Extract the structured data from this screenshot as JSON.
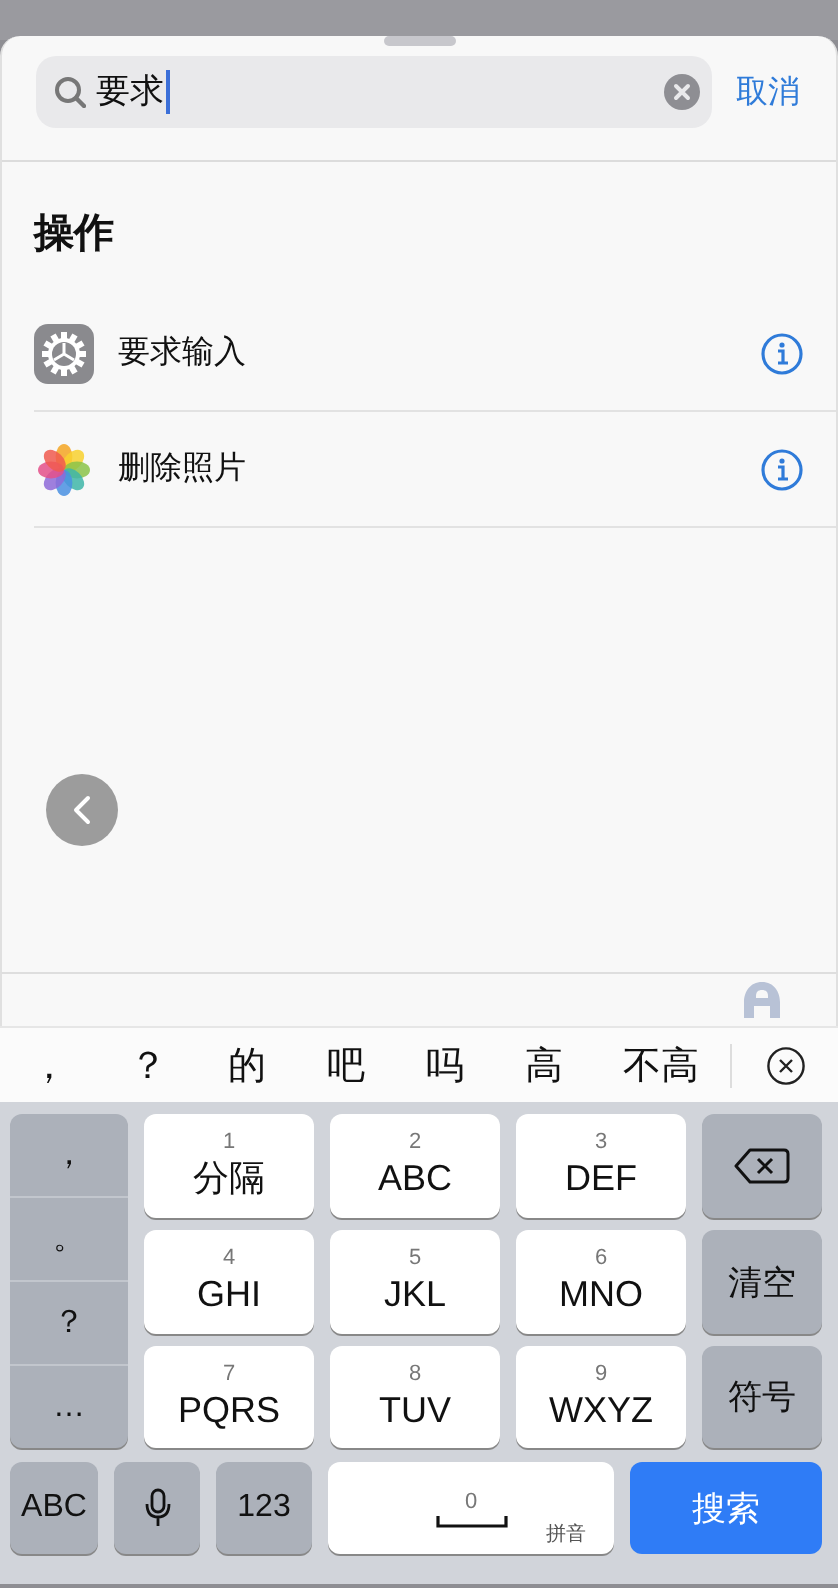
{
  "search": {
    "value": "要求",
    "cancel": "取消"
  },
  "section_title": "操作",
  "actions": [
    {
      "label": "要求输入",
      "kind": "settings"
    },
    {
      "label": "删除照片",
      "kind": "photos"
    }
  ],
  "candidates": [
    "，",
    "？",
    "的",
    "吧",
    "吗",
    "高",
    "不高"
  ],
  "keyboard": {
    "punctuation": [
      "，",
      "。",
      "？",
      "…"
    ],
    "keys": [
      {
        "digit": "1",
        "letters": "分隔"
      },
      {
        "digit": "2",
        "letters": "ABC"
      },
      {
        "digit": "3",
        "letters": "DEF"
      },
      {
        "digit": "4",
        "letters": "GHI"
      },
      {
        "digit": "5",
        "letters": "JKL"
      },
      {
        "digit": "6",
        "letters": "MNO"
      },
      {
        "digit": "7",
        "letters": "PQRS"
      },
      {
        "digit": "8",
        "letters": "TUV"
      },
      {
        "digit": "9",
        "letters": "WXYZ"
      }
    ],
    "side_keys": [
      {
        "kind": "delete"
      },
      {
        "kind": "text",
        "label": "清空"
      },
      {
        "kind": "text",
        "label": "符号"
      }
    ],
    "bottom_keys": [
      {
        "kind": "text",
        "label": "ABC"
      },
      {
        "kind": "mic"
      },
      {
        "kind": "text",
        "label": "123"
      },
      {
        "kind": "space",
        "digit": "0",
        "hint": "拼音"
      },
      {
        "kind": "action",
        "label": "搜索"
      }
    ]
  }
}
